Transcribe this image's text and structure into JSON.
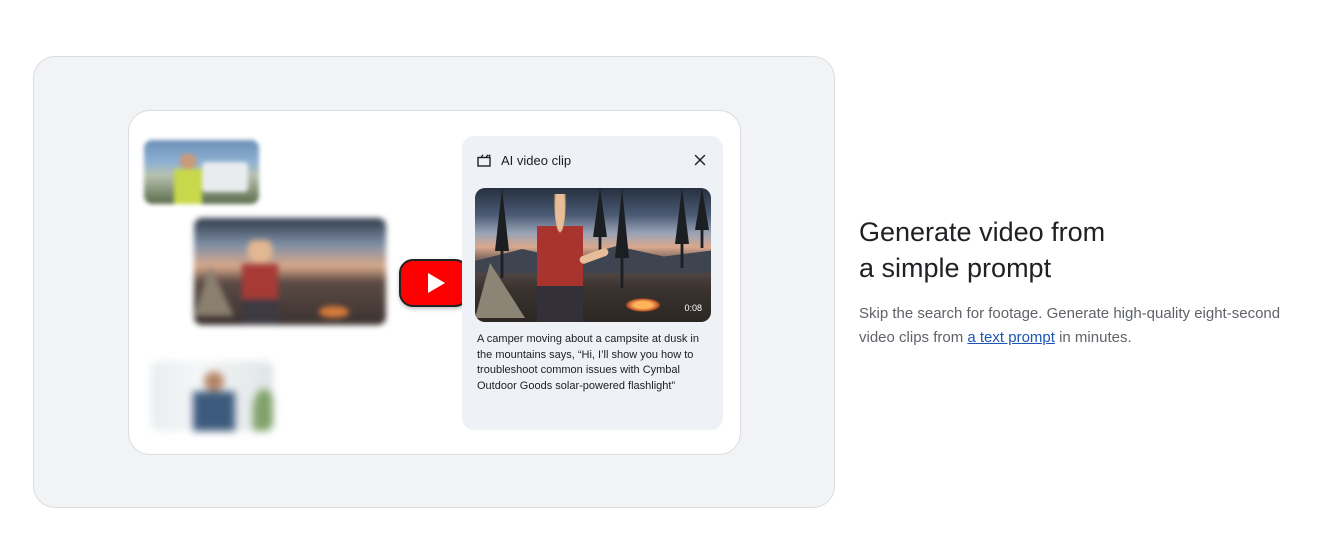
{
  "demo": {
    "panel": {
      "title": "AI video clip",
      "icon": "ai-video-clip-icon",
      "close_icon": "close-icon",
      "video_duration": "0:08",
      "caption": "A camper moving about a campsite at dusk in the mountains says, “Hi, I’ll show you how to troubleshoot common issues with Cymbal Outdoor Goods solar-powered flashlight”"
    },
    "play_button_color": "#ff0000"
  },
  "feature": {
    "headline_line1": "Generate video from",
    "headline_line2": "a simple prompt",
    "description_before": "Skip the search for footage. Generate high-quality eight-second video clips from ",
    "link_text": "a text prompt",
    "description_after": " in minutes."
  },
  "colors": {
    "link": "#1a57b5",
    "stage_bg": "#f1f3f4",
    "panel_bg": "#eef2f7"
  }
}
